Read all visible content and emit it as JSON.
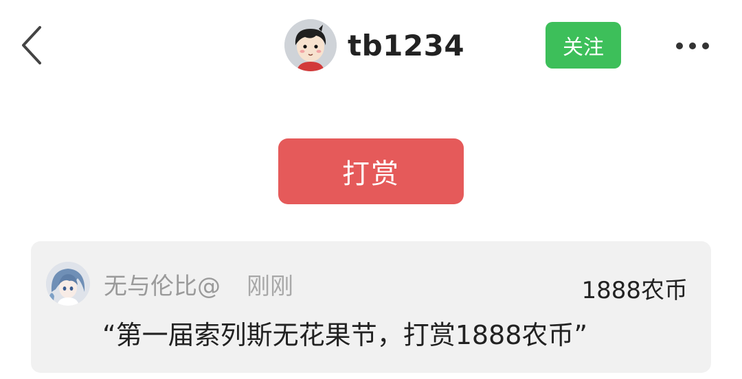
{
  "header": {
    "username": "tb1234",
    "follow_label": "关注",
    "back_icon": "chevron-left-icon",
    "more_icon": "ellipsis-icon"
  },
  "actions": {
    "tip_label": "打赏"
  },
  "tip_record": {
    "tipper_name": "无与伦比@",
    "time": "刚刚",
    "amount": "1888农币",
    "message": "“第一届索列斯无花果节，打赏1888农币”"
  },
  "colors": {
    "follow_green": "#3dbf5a",
    "tip_red": "#e55a5a",
    "card_bg": "#f1f1f1"
  }
}
